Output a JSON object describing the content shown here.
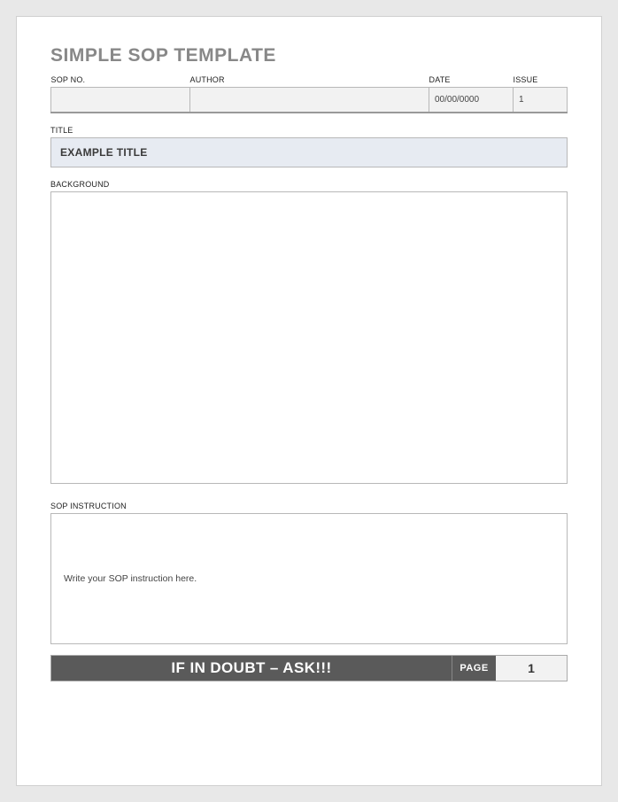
{
  "header": {
    "title": "SIMPLE SOP TEMPLATE"
  },
  "meta": {
    "sop_no_label": "SOP NO.",
    "sop_no_value": "",
    "author_label": "AUTHOR",
    "author_value": "",
    "date_label": "DATE",
    "date_value": "00/00/0000",
    "issue_label": "ISSUE",
    "issue_value": "1"
  },
  "title_section": {
    "label": "TITLE",
    "value": "EXAMPLE TITLE"
  },
  "background_section": {
    "label": "BACKGROUND",
    "value": ""
  },
  "instruction_section": {
    "label": "SOP INSTRUCTION",
    "value": "Write your SOP instruction here."
  },
  "footer": {
    "message": "IF IN DOUBT – ASK!!!",
    "page_label": "PAGE",
    "page_number": "1"
  }
}
